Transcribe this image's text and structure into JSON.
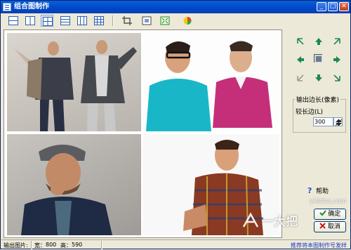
{
  "window": {
    "title": "组合图制作",
    "min_glyph": "_",
    "max_glyph": "□",
    "close_glyph": "✕"
  },
  "toolbar": {
    "tools": [
      {
        "name": "layout-rows-2-icon"
      },
      {
        "name": "layout-cols-2-icon"
      },
      {
        "name": "layout-grid-2x2-icon"
      },
      {
        "name": "layout-rows-3-icon"
      },
      {
        "name": "layout-cols-3-icon"
      },
      {
        "name": "layout-grid-3x3-icon"
      },
      {
        "name": "crop-icon"
      },
      {
        "name": "frame-icon"
      },
      {
        "name": "fit-icon"
      },
      {
        "name": "color-icon"
      }
    ]
  },
  "right_panel": {
    "output_group_title": "输出边长(像素)",
    "long_side_label": "较长边(L)",
    "long_side_value": "300",
    "help_label": "帮助",
    "ok_label": "确定",
    "cancel_label": "取消"
  },
  "status_bar": {
    "output_label": "输出图片:",
    "width_label": "宽：",
    "width_value": "800",
    "height_label": "高：",
    "height_value": "590",
    "link_text": "推荐将本图制作号发样"
  },
  "watermark": {
    "site_text": "yidaba.com",
    "brand_text": "一大把"
  },
  "colors": {
    "title_bar": "#0047c8",
    "window_face": "#ece9d8",
    "accent_link": "#1c39c8"
  }
}
